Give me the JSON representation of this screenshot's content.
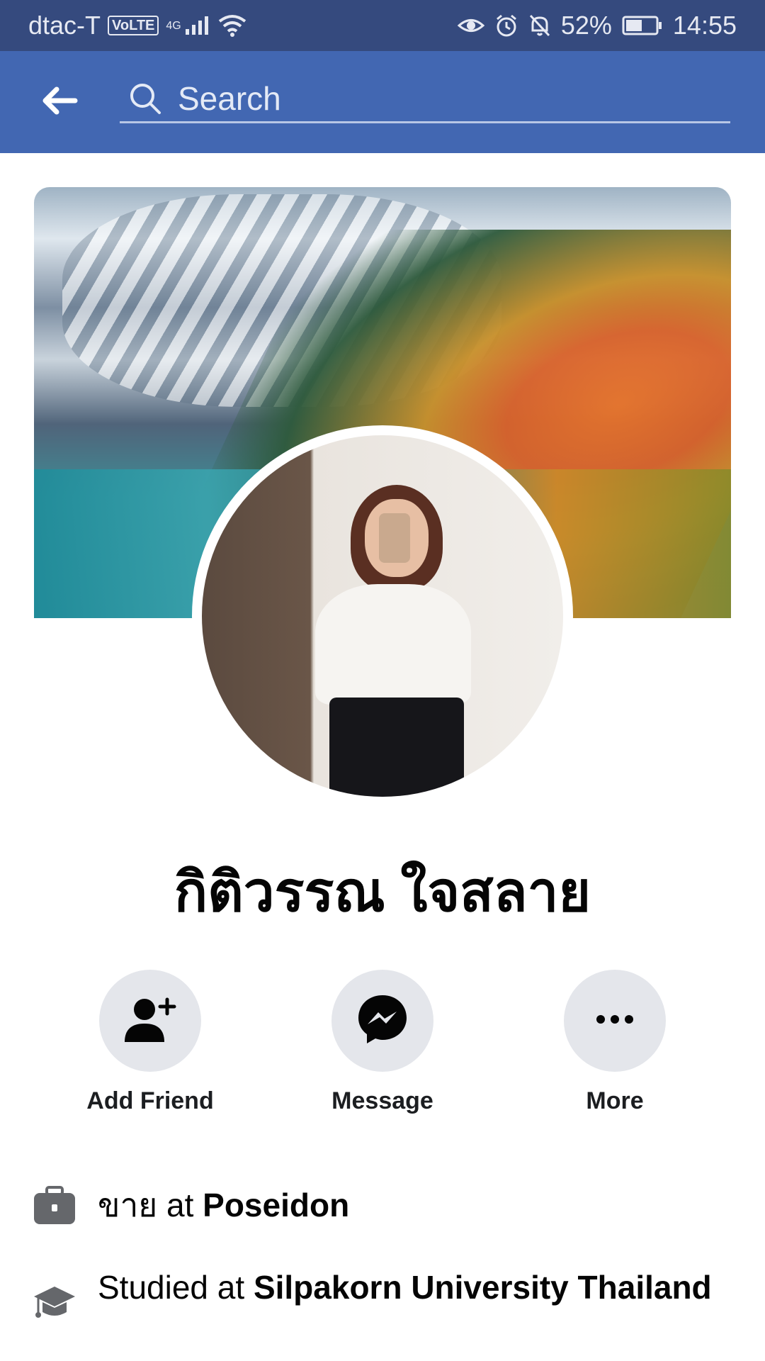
{
  "status_bar": {
    "carrier": "dtac-T",
    "volte": "VoLTE",
    "network": "4G",
    "battery": "52%",
    "time": "14:55"
  },
  "header": {
    "search_placeholder": "Search"
  },
  "profile": {
    "name": "กิติวรรณ ใจสลาย"
  },
  "actions": [
    {
      "label": "Add Friend",
      "icon": "add-friend-icon"
    },
    {
      "label": "Message",
      "icon": "messenger-icon"
    },
    {
      "label": "More",
      "icon": "more-icon"
    }
  ],
  "info": {
    "work_prefix": "ขาย at ",
    "work_place": "Poseidon",
    "study_prefix": "Studied at ",
    "study_place": "Silpakorn University Thailand"
  },
  "colors": {
    "status_bar": "#354a7e",
    "header": "#4267b2",
    "action_circle": "#e4e6eb"
  }
}
